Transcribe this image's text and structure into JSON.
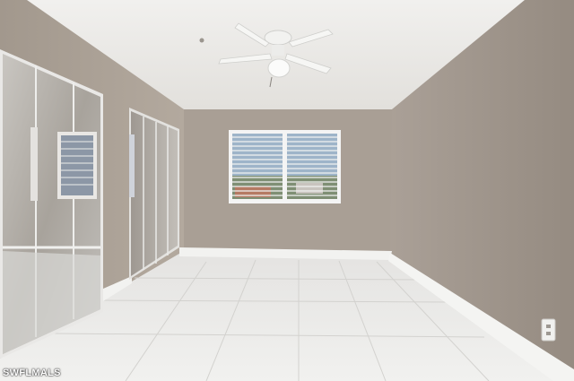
{
  "photo": {
    "subject": "empty-room",
    "colors": {
      "ceiling": "#ecebe8",
      "wall_back": "#a99f95",
      "wall_left": "#aea398",
      "wall_right": "#9f958b",
      "floor": "#e6e6e4",
      "baseboard": "#f2f2f0",
      "window_frame": "#f4f4f4",
      "mirror": "#b7b3ad"
    },
    "fixtures": [
      "ceiling-fan",
      "window-blinds",
      "mirrored-closet-doors",
      "mirrored-closet-doors-rear",
      "electrical-outlet"
    ]
  },
  "watermark": {
    "text": "SWFLMALS"
  }
}
